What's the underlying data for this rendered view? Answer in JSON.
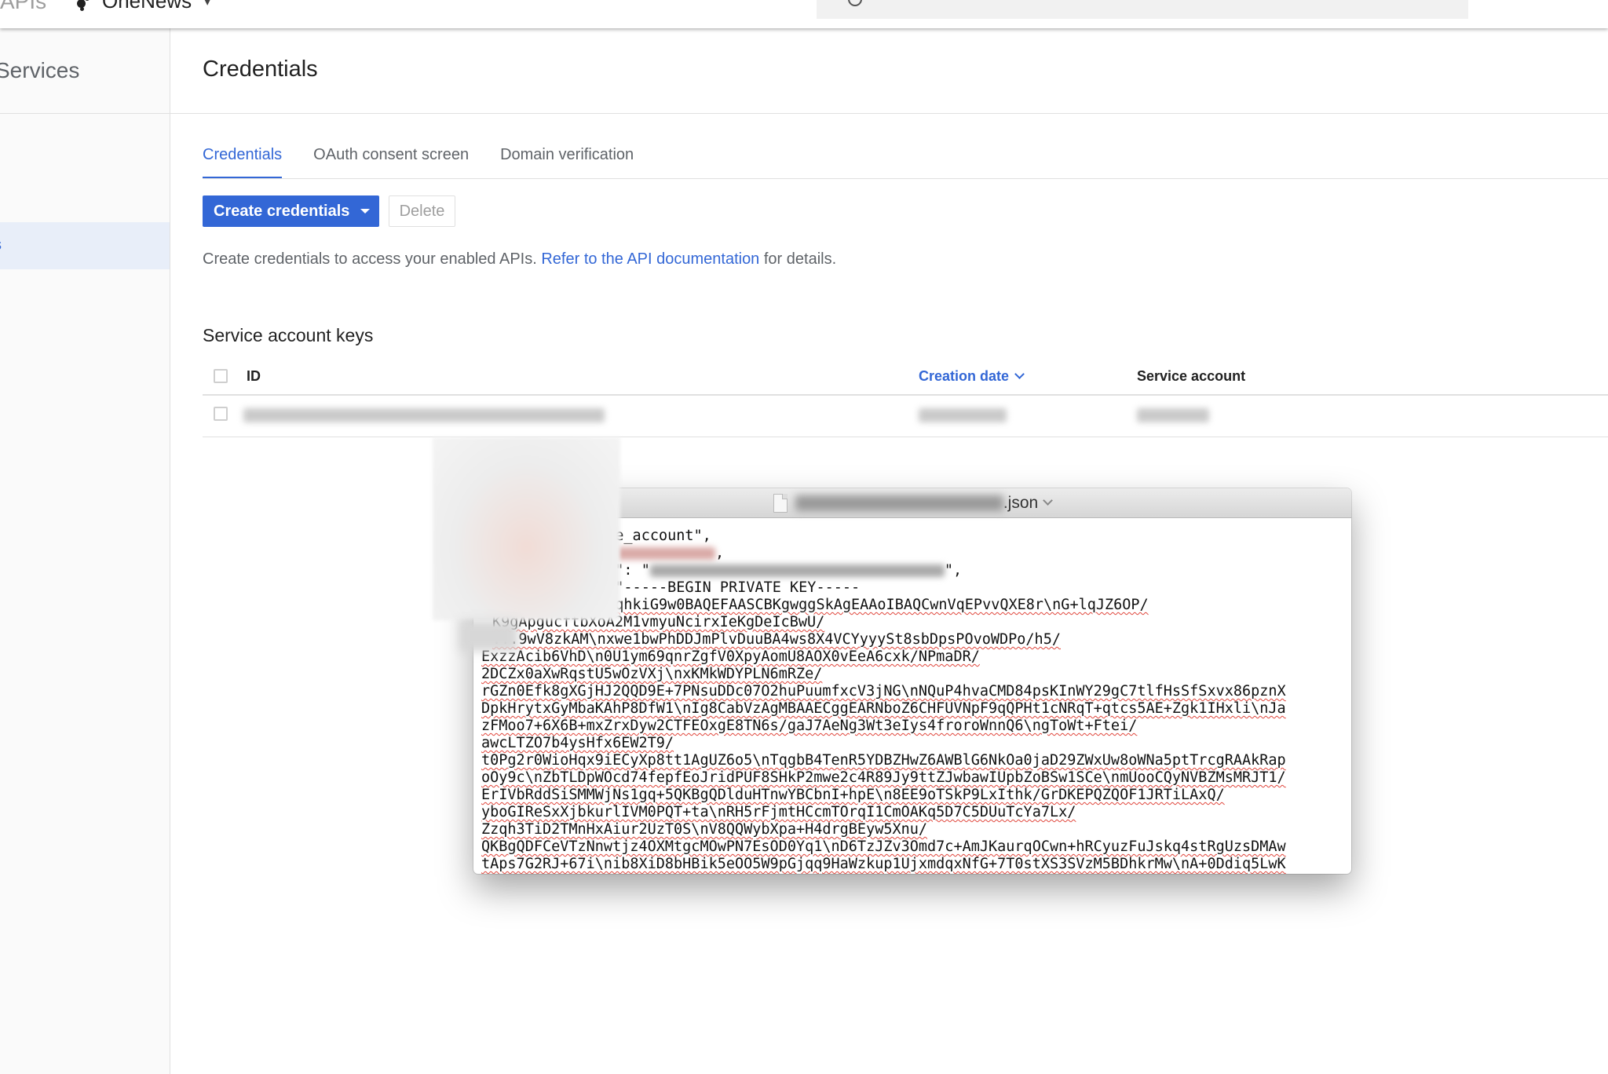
{
  "header": {
    "app_name": "APIs",
    "project_name": "OneNews",
    "project_icon": "project-dots-icon",
    "search_icon": "search-icon"
  },
  "sidebar": {
    "title": "Services",
    "active_item_label": "s"
  },
  "page": {
    "title": "Credentials",
    "tabs": [
      {
        "label": "Credentials",
        "active": true
      },
      {
        "label": "OAuth consent screen",
        "active": false
      },
      {
        "label": "Domain verification",
        "active": false
      }
    ],
    "toolbar": {
      "create_label": "Create credentials",
      "delete_label": "Delete"
    },
    "description": {
      "text": "Create credentials to access your enabled APIs. ",
      "link": "Refer to the API documentation",
      "suffix": " for details."
    },
    "accent_color": "#3367d6"
  },
  "service_account_keys": {
    "title": "Service account keys",
    "columns": [
      "ID",
      "Creation date",
      "Service account"
    ],
    "sort_column": "Creation date",
    "rows": [
      {
        "id": "[redacted]",
        "creation_date": "[redacted]",
        "service_account": "[redacted]"
      }
    ]
  },
  "file_viewer": {
    "filename_suffix": ".json",
    "lines": [
      {
        "pre": "",
        "text": "ice_account\",",
        "left": 0
      },
      {
        "pre": "",
        "text": ",",
        "left": 0,
        "blur_before": true
      },
      {
        "pre": "",
        "text": "id\": \"",
        "left": 0,
        "blur_after": true,
        "after": "\","
      },
      {
        "pre": "",
        "text": ": \"-----BEGIN PRIVATE KEY-----",
        "left": 0
      },
      {
        "pre": "",
        "text": "gkqhkiG9w0BAQEFAASCBKgwggSkAgEAAoIBAQCwnVqEPvvQXE8r\\nG+lqJZ6OP/",
        "left": 0
      },
      {
        "pre": "",
        "text": "K9gApgucftbXoA2M1vmyuNcirxIeKgDeIcBwU/",
        "left": 0
      },
      {
        "pre": "",
        "text": "...9wV8zkAM\\nxwe1bwPhDDJmPlvDuuBA4ws8X4VCYyyySt8sbDpsPOvoWDPo/h5/",
        "left": 0
      },
      {
        "pre": "",
        "text": "ExzzAcib6VhD\\n0U1ym69qnrZgfV0XpyAomU8AOX0vEeA6cxk/NPmaDR/",
        "left": 0
      },
      {
        "pre": "",
        "text": "2DCZx0aXwRqstU5wOzVXj\\nxKMkWDYPLN6mRZe/",
        "left": 0
      },
      {
        "pre": "",
        "text": "rGZn0Efk8gXGjHJ2QQD9E+7PNsuDDc07O2huPuumfxcV3jNG\\nNQuP4hvaCMD84psKInWY29gC7tlfHsSfSxvx86pznX",
        "left": 0
      },
      {
        "pre": "",
        "text": "DpkHrytxGyMbaKAhP8DfW1\\nIg8CabVzAgMBAAECggEARNboZ6CHFUVNpF9qQPHt1cNRqT+qtcs5AE+Zgk1IHxli\\nJa",
        "left": 0
      },
      {
        "pre": "",
        "text": "zFMoo7+6X6B+mxZrxDyw2CTFEOxgE8TN6s/gaJ7AeNg3Wt3eIys4froroWnnQ6\\ngToWt+Ftei/",
        "left": 0
      },
      {
        "pre": "",
        "text": "awcLTZO7b4ysHfx6EW2T9/",
        "left": 0
      },
      {
        "pre": "",
        "text": "t0Pg2r0WioHqx9iECyXp8tt1AgUZ6o5\\nTqgbB4TenR5YDBZHwZ6AWBlG6NkOa0jaD29ZWxUw8oWNa5ptTrcgRAAkRap",
        "left": 0
      },
      {
        "pre": "",
        "text": "oOy9c\\nZbTLDpWOcd74fepfEoJridPUF8SHkP2mwe2c4R89Jy9ttZJwbawIUpbZoBSw1SCe\\nmUooCQyNVBZMsMRJT1/",
        "left": 0
      },
      {
        "pre": "",
        "text": "ErIVbRddSiSMMWjNs1gq+5QKBgQDlduHTnwYBCbnI+hpE\\n8EE9oTSkP9LxIthk/GrDKEPQZQOF1JRTiLAxQ/",
        "left": 0
      },
      {
        "pre": "",
        "text": "yboGIReSxXjbkurlIVM0PQT+ta\\nRH5rFjmtHCcmTOrqI1CmOAKq5D7C5DUuTcYa7Lx/",
        "left": 0
      },
      {
        "pre": "",
        "text": "Zzqh3TiD2TMnHxAiur2UzT0S\\nV8QQWybXpa+H4drgBEyw5Xnu/",
        "left": 0
      },
      {
        "pre": "",
        "text": "QKBgQDFCeVTzNnwtjz4OXMtgcMOwPN7EsOD0Yq1\\nD6TzJZv3Omd7c+AmJKaurqOCwn+hRCyuzFuJskq4stRgUzsDMAw",
        "left": 0
      },
      {
        "pre": "",
        "text": "tAps7G2RJ+67i\\nib8XiD8bHBik5eOO5W9pGjqq9HaWzkup1UjxmdqxNfG+7T0stXS3SVzM5BDhkrMw\\nA+0Ddiq5LwK",
        "left": 0
      }
    ]
  }
}
